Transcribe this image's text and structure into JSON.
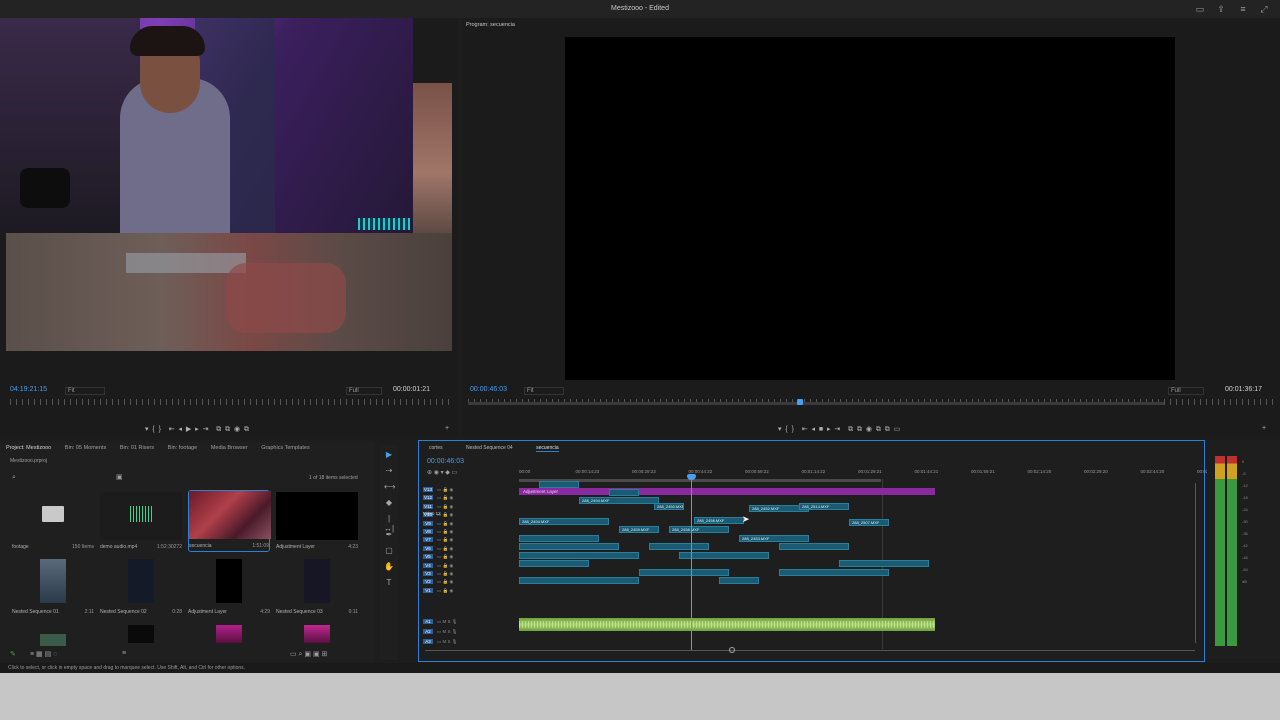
{
  "window": {
    "title": "Mestizooo - Edited"
  },
  "source_monitor": {
    "timecode_left": "04:19:21:15",
    "fit_label": "Fit",
    "quality_label": "Full",
    "timecode_right": "00:00:01:21"
  },
  "program_monitor": {
    "tab_label": "Program: secuencia",
    "timecode_left": "00:00:46:03",
    "fit_label": "Fit",
    "quality_label": "Full",
    "timecode_right": "00:01:36:17"
  },
  "project_panel": {
    "tabs": [
      "Project: Mestizooo",
      "Bin: 05 Moments",
      "Bin: 01 Risers",
      "Bin: footage",
      "Media Browser",
      "Graphics Templates"
    ],
    "project_file": "Mestizooo.prproj",
    "selection_info": "1 of 18 items selected",
    "items": [
      {
        "name": "footage",
        "meta": "150 Items",
        "color": "#c9c9c9",
        "kind": "folder"
      },
      {
        "name": "demo audio.mp4",
        "meta": "1:52:30272",
        "color": "#1c1c1c",
        "kind": "audio"
      },
      {
        "name": "secuencia",
        "meta": "1:51:09",
        "color": "#8a2030",
        "kind": "sequence"
      },
      {
        "name": "Adjustment Layer",
        "meta": "4:23",
        "color": "#000000",
        "kind": "black"
      },
      {
        "name": "Nested Sequence 01",
        "meta": "2:11",
        "color": "#3c4a5a",
        "kind": "nested"
      },
      {
        "name": "Nested Sequence 02",
        "meta": "0:28",
        "color": "#141a28",
        "kind": "nested2"
      },
      {
        "name": "Adjustment Layer",
        "meta": "4:29",
        "color": "#000000",
        "kind": "black"
      },
      {
        "name": "Nested Sequence 03",
        "meta": "0:11",
        "color": "#161624",
        "kind": "nested2"
      }
    ]
  },
  "timeline": {
    "tabs": [
      "cortes",
      "Nested Sequence 04",
      "secuencia"
    ],
    "playhead_timecode": "00:00:46:03",
    "ruler_ticks": [
      "00:00",
      "00:00:14:23",
      "00:00:29:23",
      "00:00:44:22",
      "00:00:59:22",
      "00:01:14:22",
      "00:01:29:21",
      "00:01:44:21",
      "00:01:59:21",
      "00:02:14:20",
      "00:02:29:20",
      "00:02:44:20",
      "00:02"
    ],
    "tracks": [
      "V13",
      "V12",
      "V11",
      "V10",
      "V9",
      "V8",
      "V7",
      "V6",
      "V5",
      "V4",
      "V3",
      "V2",
      "V1",
      "A1",
      "A2",
      "A3"
    ],
    "video12_label": "Video 12",
    "adjustment_clip": "Adjustment Layer",
    "clips": [
      "288_2494.MXF",
      "288_2450.MXF",
      "288_2458.MXF",
      "288_2452.MXF",
      "288_2514.MXF",
      "288_2507.MXF",
      "288_2494.MXF",
      "288_2459.MXF",
      "288_2458.MXF",
      "288_2453.MXF"
    ]
  },
  "status": {
    "hint": "Click to select, or click in empty space and drag to marquee select. Use Shift, Alt, and Ctrl for other options."
  },
  "colors": {
    "accent": "#2d7fd8",
    "timecode": "#4a9ef0",
    "adjustment": "#8a2aa0",
    "clip": "#1a5a72",
    "audio": "#a8d070"
  }
}
